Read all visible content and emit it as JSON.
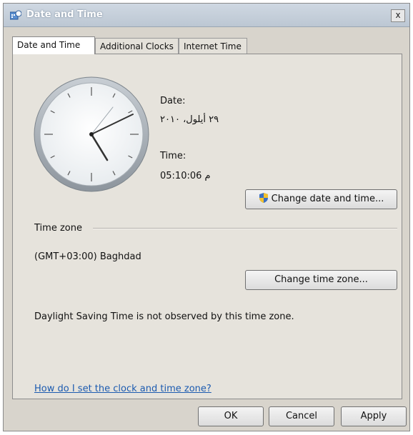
{
  "window": {
    "title": "Date and Time",
    "close_glyph": "x"
  },
  "tabs": [
    {
      "label": "Date and Time",
      "active": true
    },
    {
      "label": "Additional Clocks",
      "active": false
    },
    {
      "label": "Internet Time",
      "active": false
    }
  ],
  "date_section": {
    "date_label": "Date:",
    "date_value": "٢٩ أيلول، ٢٠١٠",
    "time_label": "Time:",
    "time_value": "05:10:06 م",
    "change_button": "Change date and time..."
  },
  "timezone": {
    "heading": "Time zone",
    "value": "(GMT+03:00) Baghdad",
    "change_button": "Change time zone...",
    "dst_note": "Daylight Saving Time is not observed by this time zone."
  },
  "help_link": "How do I set the clock and time zone?",
  "footer": {
    "ok": "OK",
    "cancel": "Cancel",
    "apply": "Apply"
  },
  "colors": {
    "link": "#1c5bb0",
    "dialog_bg": "#d8d4cc"
  },
  "icons": {
    "title": "date-time-icon",
    "uac_shield": "shield-icon"
  }
}
